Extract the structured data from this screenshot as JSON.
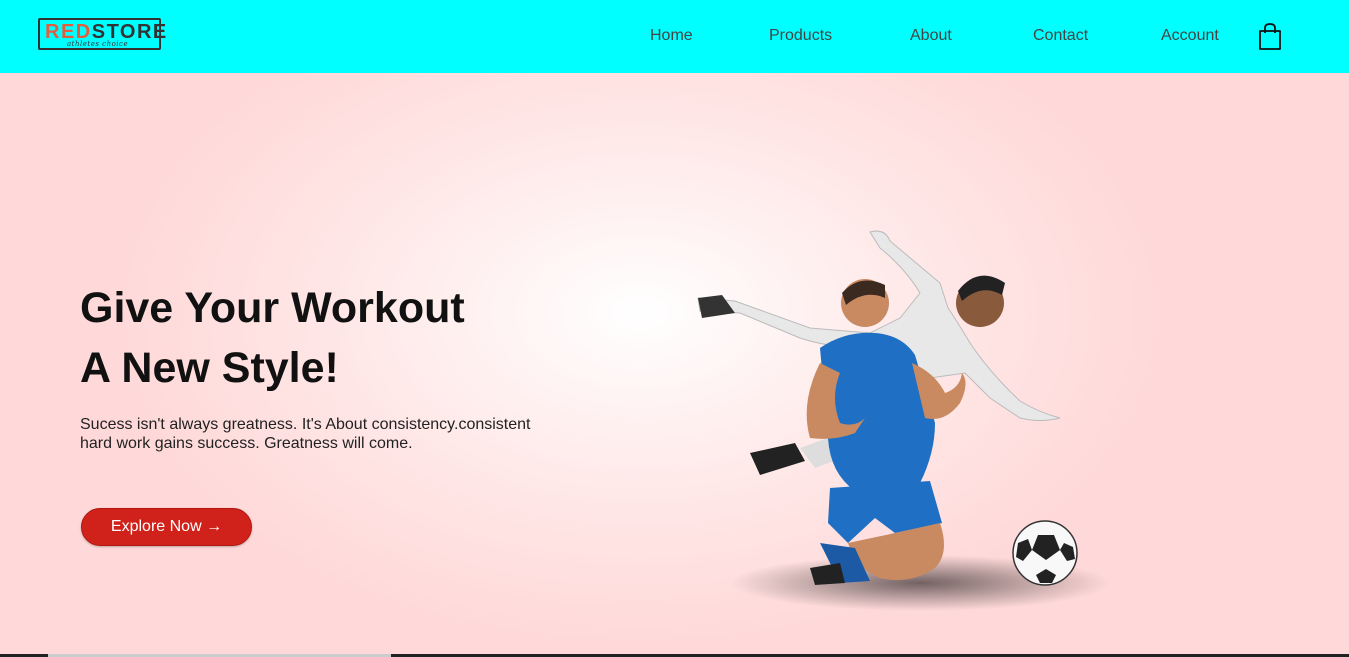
{
  "brand": {
    "logo_red": "RED",
    "logo_dark": "STORE",
    "logo_tagline": "athletes choice"
  },
  "nav": {
    "items": [
      {
        "label": "Home"
      },
      {
        "label": "Products"
      },
      {
        "label": "About"
      },
      {
        "label": "Contact"
      },
      {
        "label": "Account"
      }
    ],
    "cart_icon": "shopping-bag-icon"
  },
  "hero": {
    "headline_line1": "Give Your Workout",
    "headline_line2": "A New Style!",
    "tagline": "Sucess isn't always greatness. It's About consistency.consistent hard work gains success. Greatness will come.",
    "cta_label": "Explore Now →",
    "image": "football-players-image"
  },
  "colors": {
    "header_bg": "#00ffff",
    "hero_bg": "#ffd9d9",
    "cta_bg": "#d0221a",
    "logo_accent": "#e35d3f"
  }
}
